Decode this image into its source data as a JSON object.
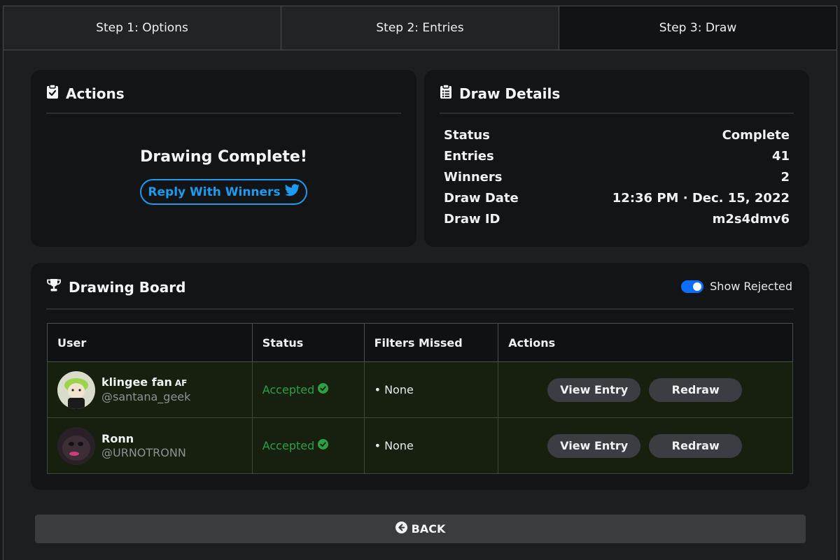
{
  "tabs": [
    {
      "label": "Step 1: Options"
    },
    {
      "label": "Step 2: Entries"
    },
    {
      "label": "Step 3: Draw"
    }
  ],
  "actions": {
    "title": "Actions",
    "complete_text": "Drawing Complete!",
    "reply_label": "Reply With Winners",
    "reply_icon": "twitter-bird-icon"
  },
  "details": {
    "title": "Draw Details",
    "rows": [
      {
        "label": "Status",
        "value": "Complete"
      },
      {
        "label": "Entries",
        "value": "41"
      },
      {
        "label": "Winners",
        "value": "2"
      },
      {
        "label": "Draw Date",
        "value": "12:36 PM · Dec. 15, 2022"
      },
      {
        "label": "Draw ID",
        "value": "m2s4dmv6"
      }
    ]
  },
  "board": {
    "title": "Drawing Board",
    "toggle_label": "Show Rejected",
    "toggle_on": true,
    "columns": [
      "User",
      "Status",
      "Filters Missed",
      "Actions"
    ],
    "rows": [
      {
        "name": "klingee fan",
        "badge": "AF",
        "handle": "@santana_geek",
        "status": "Accepted",
        "filters": "• None",
        "view_label": "View Entry",
        "redraw_label": "Redraw"
      },
      {
        "name": "Ronn",
        "badge": "",
        "handle": "@URNOTRONN",
        "status": "Accepted",
        "filters": "• None",
        "view_label": "View Entry",
        "redraw_label": "Redraw"
      }
    ]
  },
  "back_label": "BACK",
  "colors": {
    "accent_blue": "#1d9bf0",
    "toggle_blue": "#0d6efd",
    "accepted_green": "#2ea043"
  }
}
